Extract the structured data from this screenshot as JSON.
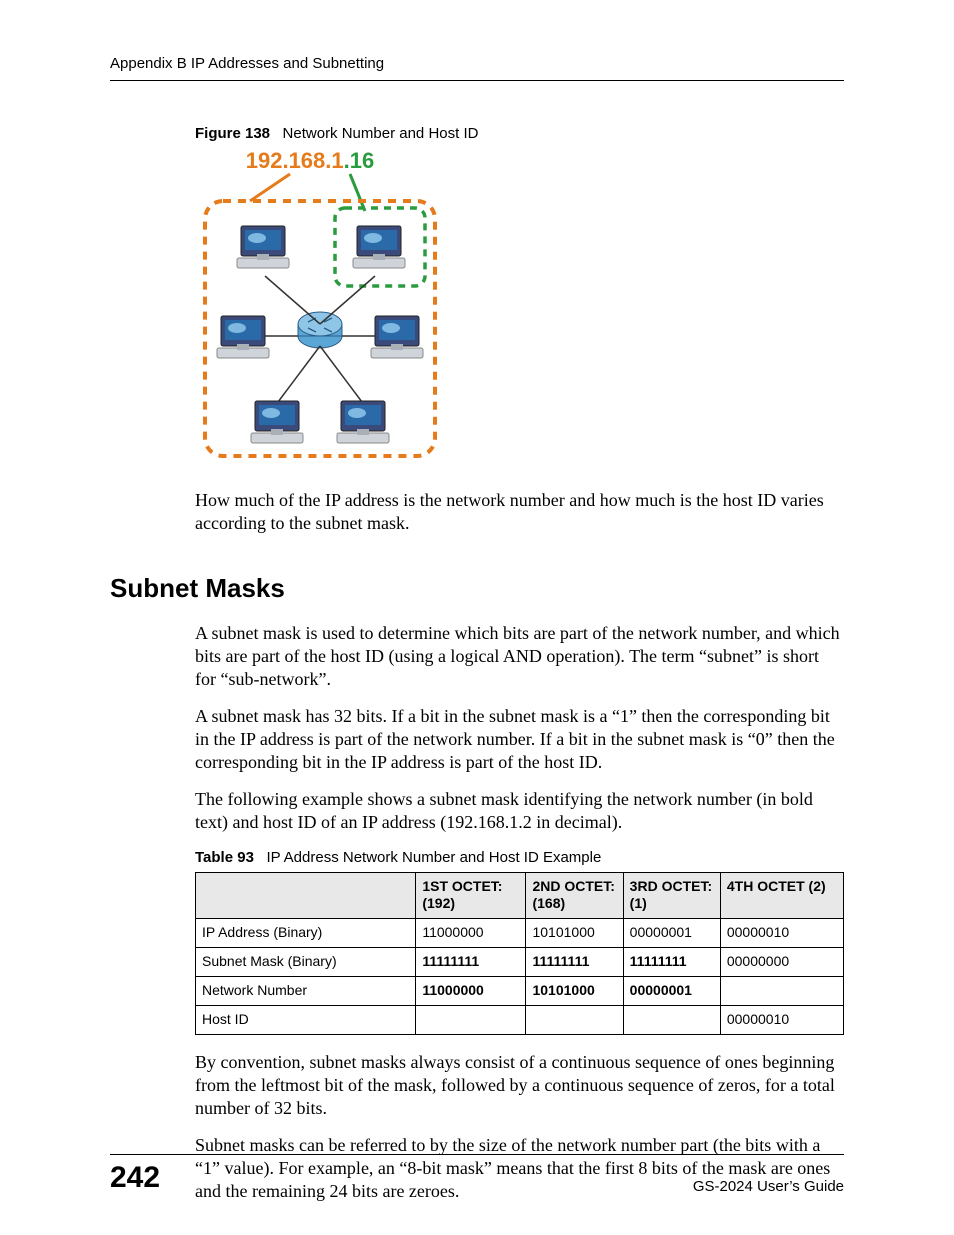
{
  "header": {
    "running_head": "Appendix B IP Addresses and Subnetting"
  },
  "figure": {
    "label": "Figure 138",
    "title": "Network Number and Host ID",
    "ip_network": "192.168.1",
    "ip_dot": ".",
    "ip_host": "16"
  },
  "para1": "How much of the IP address is the network number and how much is the host ID varies according to the subnet mask.",
  "section_heading": "Subnet Masks",
  "para2": "A subnet mask is used to determine which bits are part of the network number, and which bits are part of the host ID (using a logical AND operation). The term “subnet” is short for “sub-network”.",
  "para3": "A subnet mask has 32 bits. If a bit in the subnet mask is a “1” then the corresponding bit in the IP address is part of the network number. If a bit in the subnet mask is “0” then the corresponding bit in the IP address is part of the host ID.",
  "para4": "The following example shows a subnet mask identifying the network number (in bold text) and host ID of an IP address (192.168.1.2 in decimal).",
  "table": {
    "label": "Table 93",
    "title": "IP Address Network Number and Host ID Example",
    "headers": [
      "",
      "1ST OCTET: (192)",
      "2ND OCTET: (168)",
      "3RD OCTET: (1)",
      "4TH OCTET (2)"
    ],
    "rows": [
      {
        "label": "IP Address (Binary)",
        "c1": "11000000",
        "c1b": false,
        "c2": "10101000",
        "c2b": false,
        "c3": "00000001",
        "c3b": false,
        "c4": "00000010",
        "c4b": false
      },
      {
        "label": "Subnet Mask (Binary)",
        "c1": "11111111",
        "c1b": true,
        "c2": "11111111",
        "c2b": true,
        "c3": "11111111",
        "c3b": true,
        "c4": "00000000",
        "c4b": false
      },
      {
        "label": "Network Number",
        "c1": "11000000",
        "c1b": true,
        "c2": "10101000",
        "c2b": true,
        "c3": "00000001",
        "c3b": true,
        "c4": "",
        "c4b": false
      },
      {
        "label": "Host ID",
        "c1": "",
        "c1b": false,
        "c2": "",
        "c2b": false,
        "c3": "",
        "c3b": false,
        "c4": "00000010",
        "c4b": false
      }
    ]
  },
  "para5": "By convention, subnet masks always consist of a continuous sequence of ones beginning from the leftmost bit of the mask, followed by a continuous sequence of zeros, for a total number of 32 bits.",
  "para6": "Subnet masks can be referred to by the size of the network number part (the bits with a “1” value). For example, an “8-bit mask” means that the first 8 bits of the mask are ones and the remaining 24 bits are zeroes.",
  "footer": {
    "page_number": "242",
    "guide": "GS-2024 User’s Guide"
  }
}
